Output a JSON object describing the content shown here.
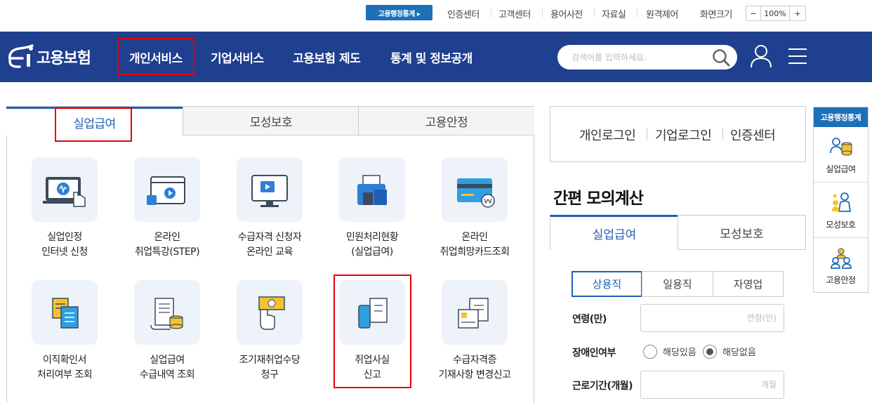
{
  "topbar": {
    "stat_button": "고용행정통계 ▸",
    "links": [
      "인증센터",
      "고객센터",
      "용어사전",
      "자료실",
      "원격제어"
    ],
    "font_size_label": "화면크기",
    "zoom_minus": "−",
    "zoom_value": "100%",
    "zoom_plus": "+"
  },
  "header": {
    "logo_text": "고용보험",
    "nav": [
      "개인서비스",
      "기업서비스",
      "고용보험 제도",
      "통계 및 정보공개"
    ],
    "search_placeholder": "검색어를 입력하세요."
  },
  "main_tabs": [
    "실업급여",
    "모성보호",
    "고용안정"
  ],
  "services": [
    {
      "line1": "실업인정",
      "line2": "인터넷 신청",
      "icon": "computer-hand-icon"
    },
    {
      "line1": "온라인",
      "line2": "취업특강(STEP)",
      "icon": "video-window-icon"
    },
    {
      "line1": "수급자격 신청자",
      "line2": "온라인 교육",
      "icon": "monitor-play-icon"
    },
    {
      "line1": "민원처리현황",
      "line2": "(실업급여)",
      "icon": "folder-printer-icon"
    },
    {
      "line1": "온라인",
      "line2": "취업희망카드조회",
      "icon": "card-won-icon"
    },
    {
      "line1": "이직확인서",
      "line2": "처리여부 조회",
      "icon": "documents-icon"
    },
    {
      "line1": "실업급여",
      "line2": "수급내역 조회",
      "icon": "scroll-coins-icon"
    },
    {
      "line1": "조기재취업수당",
      "line2": "청구",
      "icon": "hand-money-icon"
    },
    {
      "line1": "취업사실",
      "line2": "신고",
      "icon": "phone-document-icon"
    },
    {
      "line1": "수급자격증",
      "line2": "기재사항 변경신고",
      "icon": "certificate-document-icon"
    }
  ],
  "login": [
    "개인로그인",
    "기업로그인",
    "인증센터"
  ],
  "calc": {
    "title": "간편 모의계산",
    "tabs": [
      "실업급여",
      "모성보호"
    ],
    "segments": [
      "상용직",
      "일용직",
      "자영업"
    ],
    "age_label": "연령(만)",
    "age_placeholder": "연령(만)",
    "disability_label": "장애인여부",
    "disability_yes": "해당있음",
    "disability_no": "해당없음",
    "period_label": "근로기간(개월)",
    "period_placeholder": "개월"
  },
  "quick": {
    "title": "고용행정통계",
    "items": [
      "실업급여",
      "모성보호",
      "고용안정"
    ]
  },
  "colors": {
    "navy": "#1f3f8f",
    "accent_blue": "#1d6fb8",
    "highlight_red": "#e8000b"
  }
}
